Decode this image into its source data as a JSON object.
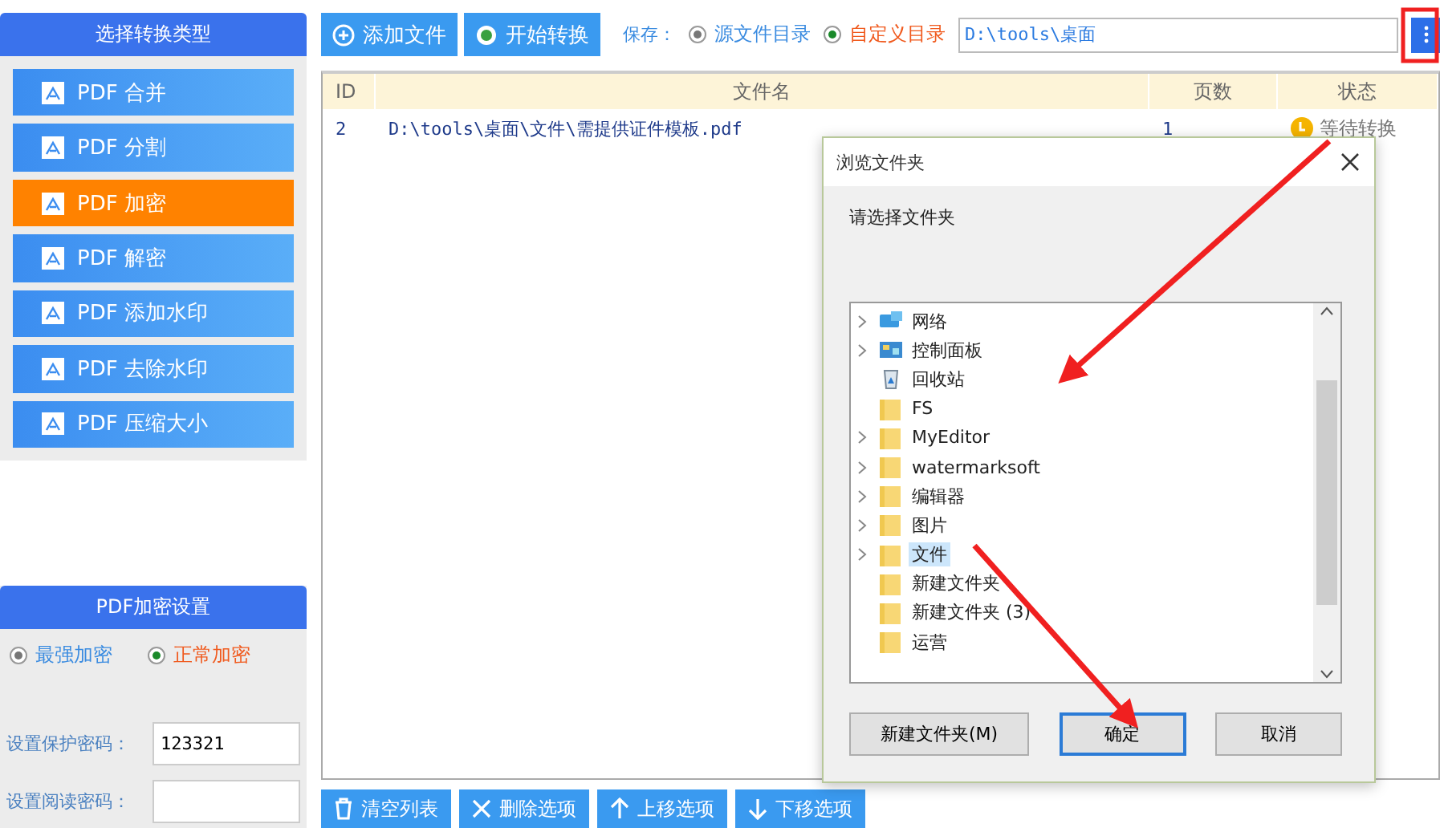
{
  "sidebar": {
    "title": "选择转换类型",
    "items": [
      {
        "label": "PDF 合并",
        "selected": false
      },
      {
        "label": "PDF 分割",
        "selected": false
      },
      {
        "label": "PDF 加密",
        "selected": true
      },
      {
        "label": "PDF 解密",
        "selected": false
      },
      {
        "label": "PDF 添加水印",
        "selected": false
      },
      {
        "label": "PDF 去除水印",
        "selected": false
      },
      {
        "label": "PDF 压缩大小",
        "selected": false
      }
    ]
  },
  "settings": {
    "title": "PDF加密设置",
    "modes": [
      {
        "label": "最强加密",
        "selected": false
      },
      {
        "label": "正常加密",
        "selected": true
      }
    ],
    "fields": [
      {
        "label": "设置保护密码：",
        "value": "123321"
      },
      {
        "label": "设置阅读密码："
      }
    ]
  },
  "toolbar": {
    "buttons": [
      {
        "label": "添加文件",
        "kind": "add"
      },
      {
        "label": "开始转换",
        "kind": "start"
      }
    ],
    "save_label": "保存：",
    "save_options": [
      {
        "label": "源文件目录",
        "selected": false
      },
      {
        "label": "自定义目录",
        "selected": true
      }
    ],
    "path": "D:\\tools\\桌面"
  },
  "table": {
    "columns": [
      "ID",
      "文件名",
      "页数",
      "状态"
    ],
    "rows": [
      {
        "id": "2",
        "file": "D:\\tools\\桌面\\文件\\需提供证件模板.pdf",
        "pages": "1",
        "status": "等待转换"
      }
    ]
  },
  "bottom_buttons": [
    {
      "label": "清空列表",
      "kind": "clear"
    },
    {
      "label": "删除选项",
      "kind": "delete"
    },
    {
      "label": "上移选项",
      "kind": "up"
    },
    {
      "label": "下移选项",
      "kind": "down"
    }
  ],
  "dialog": {
    "title": "浏览文件夹",
    "prompt": "请选择文件夹",
    "tree": [
      {
        "label": "网络",
        "kind": "network",
        "expandable": true,
        "selected": false
      },
      {
        "label": "控制面板",
        "kind": "control",
        "expandable": true,
        "selected": false
      },
      {
        "label": "回收站",
        "kind": "recycle",
        "expandable": false,
        "selected": false
      },
      {
        "label": "FS",
        "kind": "folder",
        "expandable": false,
        "selected": false
      },
      {
        "label": "MyEditor",
        "kind": "folder",
        "expandable": true,
        "selected": false
      },
      {
        "label": "watermarksoft",
        "kind": "folder",
        "expandable": true,
        "selected": false
      },
      {
        "label": "编辑器",
        "kind": "folder",
        "expandable": true,
        "selected": false
      },
      {
        "label": "图片",
        "kind": "folder",
        "expandable": true,
        "selected": false
      },
      {
        "label": "文件",
        "kind": "folder",
        "expandable": true,
        "selected": true
      },
      {
        "label": "新建文件夹",
        "kind": "folder",
        "expandable": false,
        "selected": false
      },
      {
        "label": "新建文件夹 (3)",
        "kind": "folder",
        "expandable": false,
        "selected": false
      },
      {
        "label": "运营",
        "kind": "folder",
        "expandable": false,
        "selected": false
      }
    ],
    "buttons": [
      {
        "label": "新建文件夹(M)",
        "default": false
      },
      {
        "label": "确定",
        "default": true
      },
      {
        "label": "取消",
        "default": false
      }
    ]
  }
}
